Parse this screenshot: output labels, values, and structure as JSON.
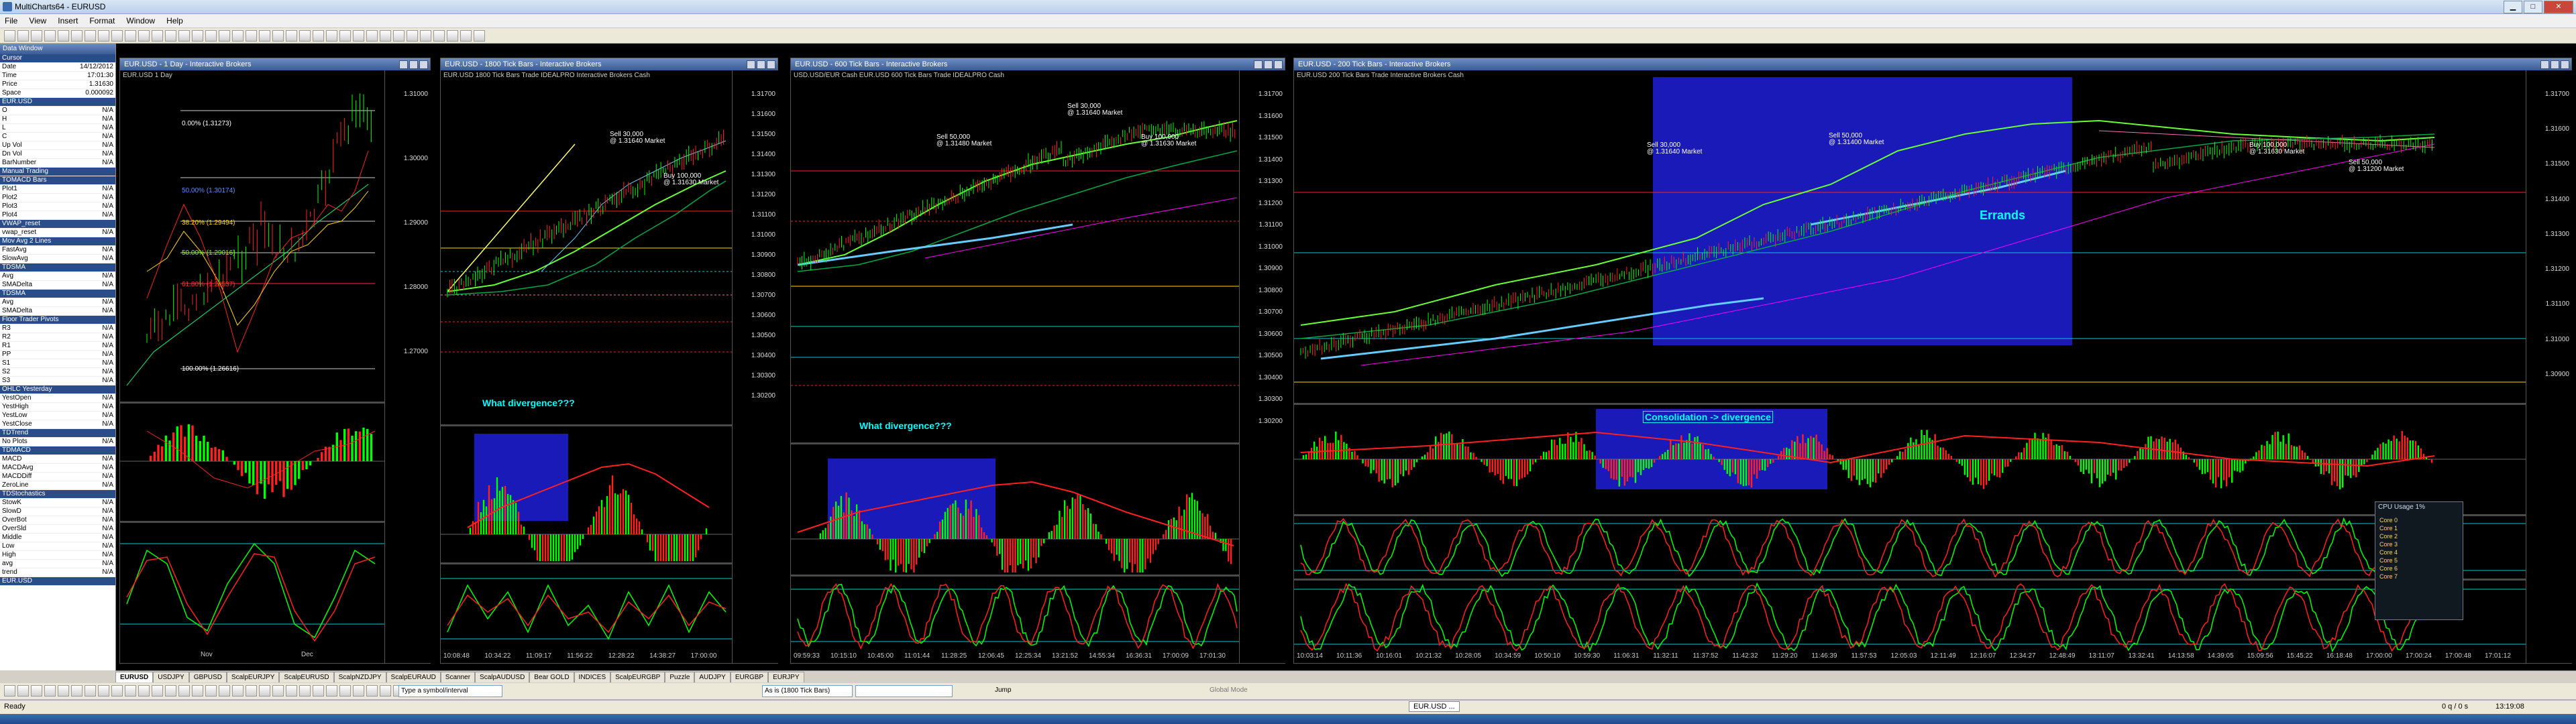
{
  "app": {
    "title": "MultiCharts64 - EURUSD"
  },
  "menu": [
    "File",
    "View",
    "Insert",
    "Format",
    "Window",
    "Help"
  ],
  "data_window": {
    "title": "Data Window",
    "rows": [
      {
        "k": "Cursor",
        "v": "",
        "sec": true
      },
      {
        "k": "Date",
        "v": "14/12/2012"
      },
      {
        "k": "Time",
        "v": "17:01:30"
      },
      {
        "k": "Price",
        "v": "1.31630"
      },
      {
        "k": "Space",
        "v": "0.000092"
      },
      {
        "k": "EUR.USD",
        "v": "",
        "sec": true
      },
      {
        "k": "O",
        "v": "N/A"
      },
      {
        "k": "H",
        "v": "N/A"
      },
      {
        "k": "L",
        "v": "N/A"
      },
      {
        "k": "C",
        "v": "N/A"
      },
      {
        "k": "Up Vol",
        "v": "N/A"
      },
      {
        "k": "Dn Vol",
        "v": "N/A"
      },
      {
        "k": "BarNumber",
        "v": "N/A"
      },
      {
        "k": "Manual Trading",
        "v": "",
        "sec": true
      },
      {
        "k": "TOMACD Bars",
        "v": "",
        "sec": true
      },
      {
        "k": "Plot1",
        "v": "N/A"
      },
      {
        "k": "Plot2",
        "v": "N/A"
      },
      {
        "k": "Plot3",
        "v": "N/A"
      },
      {
        "k": "Plot4",
        "v": "N/A"
      },
      {
        "k": "VWAP_reset",
        "v": "",
        "sec": true
      },
      {
        "k": "vwap_reset",
        "v": "N/A"
      },
      {
        "k": "Mov Avg 2 Lines",
        "v": "",
        "sec": true
      },
      {
        "k": "FastAvg",
        "v": "N/A"
      },
      {
        "k": "SlowAvg",
        "v": "N/A"
      },
      {
        "k": "TDSMA",
        "v": "",
        "sec": true
      },
      {
        "k": "Avg",
        "v": "N/A"
      },
      {
        "k": "SMADelta",
        "v": "N/A"
      },
      {
        "k": "TDSMA",
        "v": "",
        "sec": true
      },
      {
        "k": "Avg",
        "v": "N/A"
      },
      {
        "k": "SMADelta",
        "v": "N/A"
      },
      {
        "k": "Floor Trader Pivots",
        "v": "",
        "sec": true
      },
      {
        "k": "R3",
        "v": "N/A"
      },
      {
        "k": "R2",
        "v": "N/A"
      },
      {
        "k": "R1",
        "v": "N/A"
      },
      {
        "k": "PP",
        "v": "N/A"
      },
      {
        "k": "S1",
        "v": "N/A"
      },
      {
        "k": "S2",
        "v": "N/A"
      },
      {
        "k": "S3",
        "v": "N/A"
      },
      {
        "k": "OHLC Yesterday",
        "v": "",
        "sec": true
      },
      {
        "k": "YestOpen",
        "v": "N/A"
      },
      {
        "k": "YestHigh",
        "v": "N/A"
      },
      {
        "k": "YestLow",
        "v": "N/A"
      },
      {
        "k": "YestClose",
        "v": "N/A"
      },
      {
        "k": "TDTrend",
        "v": "",
        "sec": true
      },
      {
        "k": "No Plots",
        "v": "N/A"
      },
      {
        "k": "TDMACD",
        "v": "",
        "sec": true
      },
      {
        "k": "MACD",
        "v": "N/A"
      },
      {
        "k": "MACDAvg",
        "v": "N/A"
      },
      {
        "k": "MACDDiff",
        "v": "N/A"
      },
      {
        "k": "ZeroLine",
        "v": "N/A"
      },
      {
        "k": "TDStochastics",
        "v": "",
        "sec": true
      },
      {
        "k": "StowK",
        "v": "N/A"
      },
      {
        "k": "SlowD",
        "v": "N/A"
      },
      {
        "k": "OverBot",
        "v": "N/A"
      },
      {
        "k": "OverSld",
        "v": "N/A"
      },
      {
        "k": "Middle",
        "v": "N/A"
      },
      {
        "k": "Low",
        "v": "N/A"
      },
      {
        "k": "High",
        "v": "N/A"
      },
      {
        "k": "avg",
        "v": "N/A"
      },
      {
        "k": "trend",
        "v": "N/A"
      },
      {
        "k": "EUR.USD",
        "v": "",
        "sec": true
      }
    ]
  },
  "panels": [
    {
      "id": "p1",
      "title": "EUR.USD - 1 Day - Interactive Brokers",
      "info": "EUR.USD  1 Day",
      "axis": [
        "1.31000",
        "1.30000",
        "1.29000",
        "1.28000",
        "1.27000"
      ],
      "fib": [
        "0.00% (1.31273)",
        "50.00% (1.30174)",
        "38.20% (1.29494)",
        "50.00% (1.29016)",
        "61.80% (1.28537)",
        "100.00% (1.26616)"
      ],
      "x": [
        "Nov",
        "Dec"
      ]
    },
    {
      "id": "p2",
      "title": "EUR.USD - 1800 Tick Bars - Interactive Brokers",
      "info": "EUR.USD   1800 Tick Bars   Trade  IDEALPRO  Interactive Brokers  Cash",
      "axis": [
        "1.31700",
        "1.31600",
        "1.31500",
        "1.31400",
        "1.31300",
        "1.31200",
        "1.31100",
        "1.31000",
        "1.30900",
        "1.30800",
        "1.30700",
        "1.30600",
        "1.30500",
        "1.30400",
        "1.30300",
        "1.30200"
      ],
      "note": "What divergence???",
      "x": [
        "10:08:48",
        "10:34:22",
        "11:09:17",
        "11:56:22",
        "12:28:22",
        "14:38:27",
        "17:00:00"
      ]
    },
    {
      "id": "p3",
      "title": "EUR.USD - 600 Tick Bars - Interactive Brokers",
      "info": "USD.USD/EUR Cash EUR.USD   600 Tick Bars   Trade  IDEALPRO  Cash",
      "axis": [
        "1.31700",
        "1.31600",
        "1.31500",
        "1.31400",
        "1.31300",
        "1.31200",
        "1.31100",
        "1.31000",
        "1.30900",
        "1.30800",
        "1.30700",
        "1.30600",
        "1.30500",
        "1.30400",
        "1.30300",
        "1.30200"
      ],
      "note": "What divergence???",
      "x": [
        "09:59:33",
        "10:15:10",
        "10:45:00",
        "11:01:44",
        "11:28:25",
        "12:06:45",
        "12:25:34",
        "13:21:52",
        "14:55:34",
        "16:36:31",
        "17:00:09",
        "17:01:30"
      ]
    },
    {
      "id": "p4",
      "title": "EUR.USD - 200 Tick Bars - Interactive Brokers",
      "info": "EUR.USD   200 Tick Bars   Trade  Interactive Brokers  Cash",
      "axis": [
        "1.31700",
        "1.31600",
        "1.31500",
        "1.31400",
        "1.31300",
        "1.31200",
        "1.31100",
        "1.31000",
        "1.30900"
      ],
      "notes": [
        "Errands",
        "Consolidation -> divergence"
      ],
      "x": [
        "10:03:14",
        "10:11:36",
        "10:16:01",
        "10:21:32",
        "10:28:05",
        "10:34:59",
        "10:50:10",
        "10:59:30",
        "11:06:31",
        "11:32:11",
        "11:37:52",
        "11:42:32",
        "11:29:20",
        "11:46:39",
        "11:57:53",
        "12:05:03",
        "12:11:49",
        "12:16:07",
        "12:34:27",
        "12:48:49",
        "13:11:07",
        "13:32:41",
        "14:13:58",
        "14:39:05",
        "15:09:56",
        "15:45:22",
        "16:18:48",
        "17:00:00",
        "17:00:24",
        "17:00:48",
        "17:01:12"
      ]
    }
  ],
  "orders": {
    "p2": [
      "Sell 30,000",
      "@ 1.31640 Market",
      "Buy 100,000",
      "@ 1.31630 Market"
    ],
    "p3": [
      "Sell 30,000",
      "@ 1.31640 Market",
      "Buy 100,000",
      "@ 1.31630 Market",
      "Sell 50,000",
      "@ 1.31480 Market"
    ],
    "p4": [
      "Sell 30,000",
      "@ 1.31640 Market",
      "Sell 50,000",
      "@ 1.31400 Market",
      "Buy 100,000",
      "@ 1.31630 Market",
      "Sell 50,000",
      "@ 1.31200 Market"
    ]
  },
  "tabs": [
    "EURUSD",
    "USDJPY",
    "GBPUSD",
    "ScalpEURJPY",
    "ScalpEURUSD",
    "ScalpNZDJPY",
    "ScalpEURAUD",
    "Scanner",
    "ScalpAUDUSD",
    "Bear GOLD",
    "INDICES",
    "ScalpEURGBP",
    "Puzzle",
    "AUDJPY",
    "EURGBP",
    "EURJPY"
  ],
  "toolbar2": {
    "symbol_placeholder": "Type a symbol/interval",
    "resolution": "As is (1800 Tick Bars)",
    "jump": "Jump",
    "global_mode": "Global Mode"
  },
  "status": {
    "left": "Ready",
    "right": "0 q / 0 s",
    "time": "13:19:08"
  },
  "task": {
    "label": "EUR.USD ..."
  },
  "cpu": {
    "title": "CPU Usage",
    "pct": "1%",
    "cores": [
      "Core 0",
      "Core 1",
      "Core 2",
      "Core 3",
      "Core 4",
      "Core 5",
      "Core 6",
      "Core 7"
    ]
  },
  "colors": {
    "bg": "#000000",
    "up": "#00ff00",
    "down": "#ff2020",
    "box": "#1a1ab8",
    "note": "#00ffff"
  }
}
